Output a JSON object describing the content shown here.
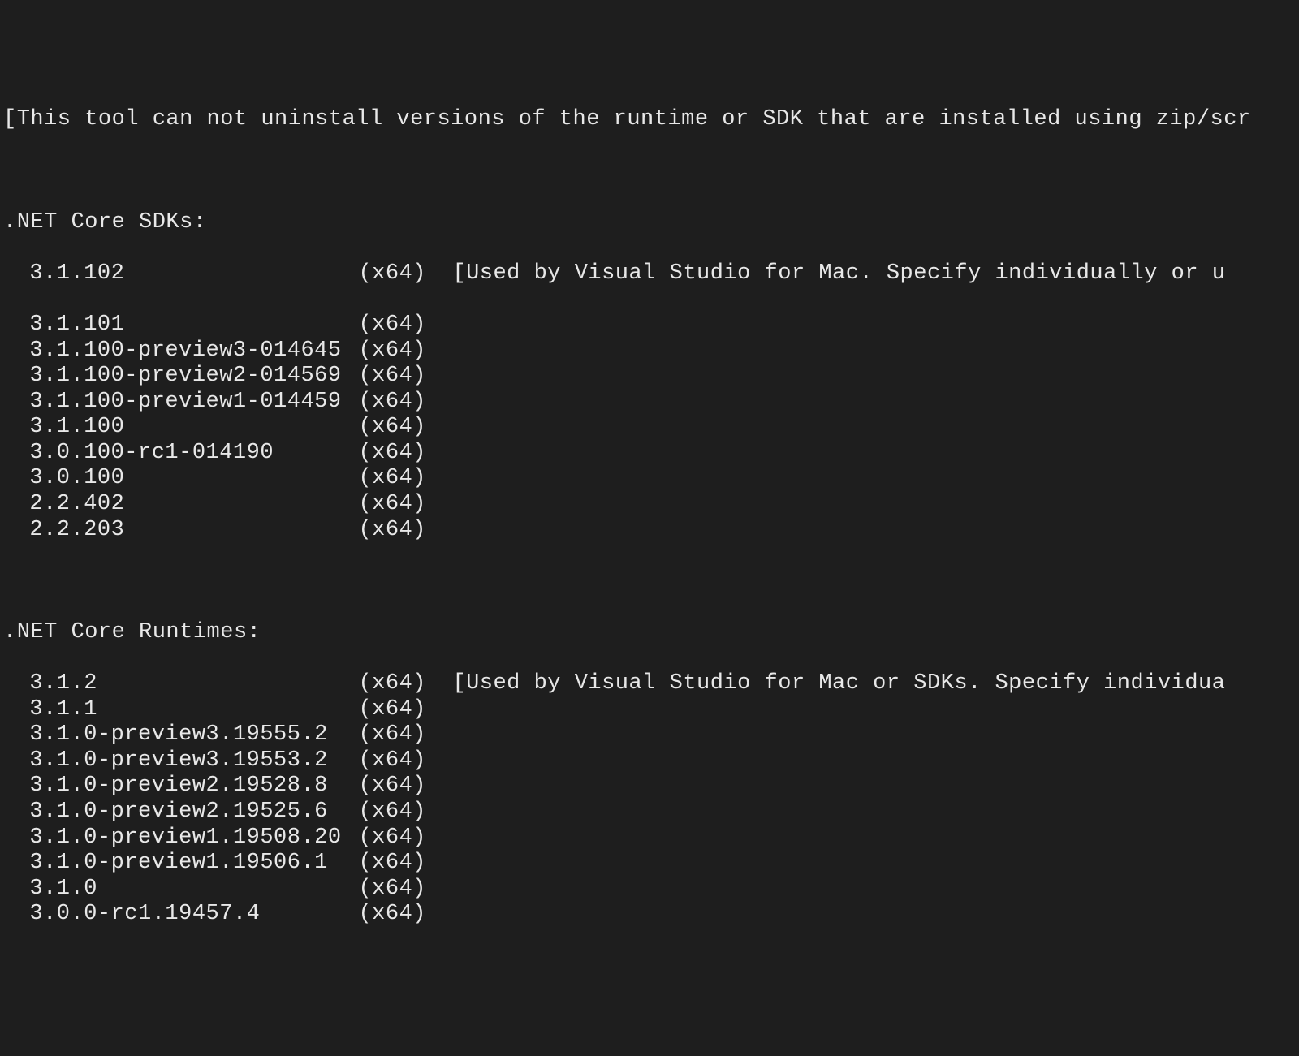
{
  "header_notice": "[This tool can not uninstall versions of the runtime or SDK that are installed using zip/scr",
  "sdk_section": {
    "title": ".NET Core SDKs:",
    "items": [
      {
        "version": "3.1.102",
        "arch": "(x64)",
        "note": "[Used by Visual Studio for Mac. Specify individually or u"
      },
      {
        "blank": true
      },
      {
        "version": "3.1.101",
        "arch": "(x64)",
        "note": ""
      },
      {
        "version": "3.1.100-preview3-014645",
        "arch": "(x64)",
        "note": ""
      },
      {
        "version": "3.1.100-preview2-014569",
        "arch": "(x64)",
        "note": ""
      },
      {
        "version": "3.1.100-preview1-014459",
        "arch": "(x64)",
        "note": ""
      },
      {
        "version": "3.1.100",
        "arch": "(x64)",
        "note": ""
      },
      {
        "version": "3.0.100-rc1-014190",
        "arch": "(x64)",
        "note": ""
      },
      {
        "version": "3.0.100",
        "arch": "(x64)",
        "note": ""
      },
      {
        "version": "2.2.402",
        "arch": "(x64)",
        "note": ""
      },
      {
        "version": "2.2.203",
        "arch": "(x64)",
        "note": ""
      }
    ]
  },
  "runtime_section": {
    "title": ".NET Core Runtimes:",
    "items": [
      {
        "version": "3.1.2",
        "arch": "(x64)",
        "note": "[Used by Visual Studio for Mac or SDKs. Specify individua"
      },
      {
        "version": "3.1.1",
        "arch": "(x64)",
        "note": ""
      },
      {
        "version": "3.1.0-preview3.19555.2",
        "arch": "(x64)",
        "note": ""
      },
      {
        "version": "3.1.0-preview3.19553.2",
        "arch": "(x64)",
        "note": ""
      },
      {
        "version": "3.1.0-preview2.19528.8",
        "arch": "(x64)",
        "note": ""
      },
      {
        "version": "3.1.0-preview2.19525.6",
        "arch": "(x64)",
        "note": ""
      },
      {
        "version": "3.1.0-preview1.19508.20",
        "arch": "(x64)",
        "note": ""
      },
      {
        "version": "3.1.0-preview1.19506.1",
        "arch": "(x64)",
        "note": ""
      },
      {
        "version": "3.1.0",
        "arch": "(x64)",
        "note": ""
      },
      {
        "version": "3.0.0-rc1.19457.4",
        "arch": "(x64)",
        "note": ""
      }
    ]
  }
}
